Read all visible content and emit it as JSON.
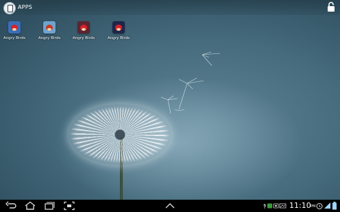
{
  "topbar": {
    "apps_label": "APPS"
  },
  "apps": [
    {
      "label": "Angry Birds",
      "tile_color": "#3a6fb8"
    },
    {
      "label": "Angry Birds",
      "tile_color": "#6fa3cf"
    },
    {
      "label": "Angry Birds",
      "tile_color": "#5a2530"
    },
    {
      "label": "Angry Birds",
      "tile_color": "#20264a"
    }
  ],
  "statusbar": {
    "time": "11:10",
    "ampm": "PM"
  },
  "colors": {
    "accent_wallpaper": "#456b7d",
    "navbar": "#000000"
  }
}
